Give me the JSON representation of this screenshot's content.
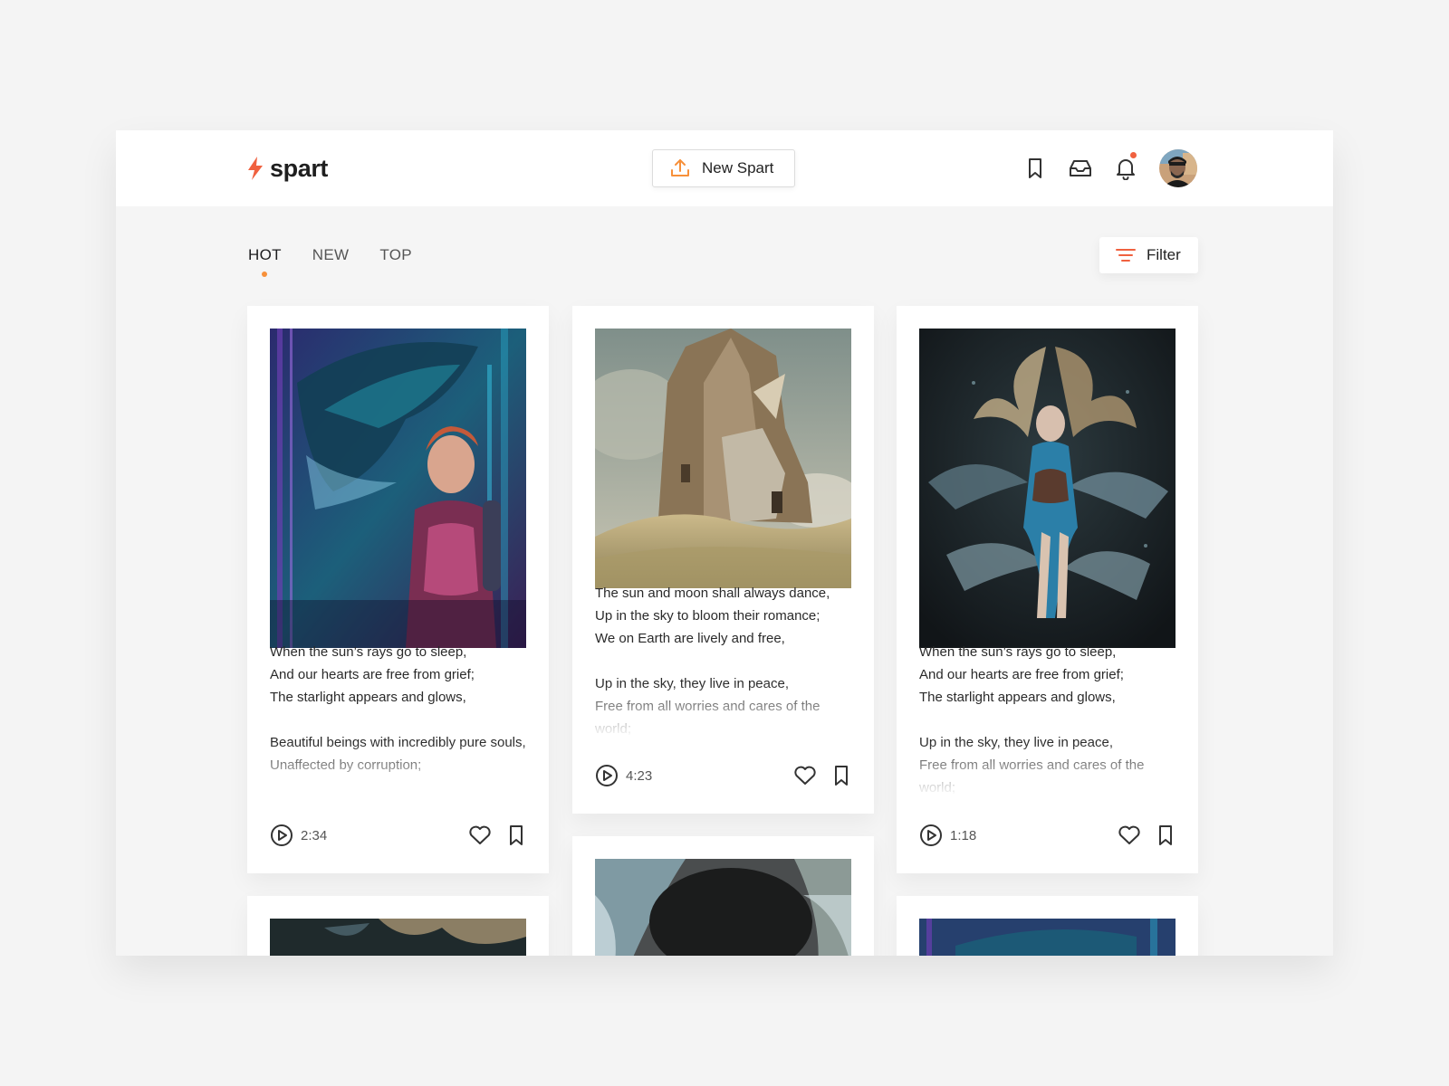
{
  "app": {
    "name": "spart",
    "accent": "#f0613f",
    "accent_orange": "#f7903a"
  },
  "header": {
    "new_button_label": "New Spart",
    "icons": [
      "bookmark-icon",
      "inbox-icon",
      "bell-icon"
    ],
    "has_notification": true
  },
  "tabs": [
    {
      "label": "HOT",
      "active": true
    },
    {
      "label": "NEW",
      "active": false
    },
    {
      "label": "TOP",
      "active": false
    }
  ],
  "filter": {
    "label": "Filter"
  },
  "cards": [
    {
      "image": "cyberpunk-woman-with-creature",
      "text": "When the sun’s rays go to sleep,\nAnd our hearts are free from grief;\nThe starlight appears and glows,\n\nBeautiful beings with incredibly pure souls,\nUnaffected by corruption;",
      "duration": "2:34"
    },
    {
      "image": "desert-castle",
      "text": "The sun and moon shall always dance,\nUp in the sky to bloom their romance;\nWe on Earth are lively and free,\n\nUp in the sky, they live in peace,\nFree from all worries and cares of the world;",
      "duration": "4:23"
    },
    {
      "image": "siren-with-serpents",
      "text": "When the sun’s rays go to sleep,\nAnd our hearts are free from grief;\nThe starlight appears and glows,\n\nUp in the sky, they live in peace,\nFree from all worries and cares of the world;",
      "duration": "1:18"
    },
    {
      "image": "siren-with-serpents-partial"
    },
    {
      "image": "waterfall-chasm-partial"
    },
    {
      "image": "cyberpunk-partial"
    }
  ]
}
